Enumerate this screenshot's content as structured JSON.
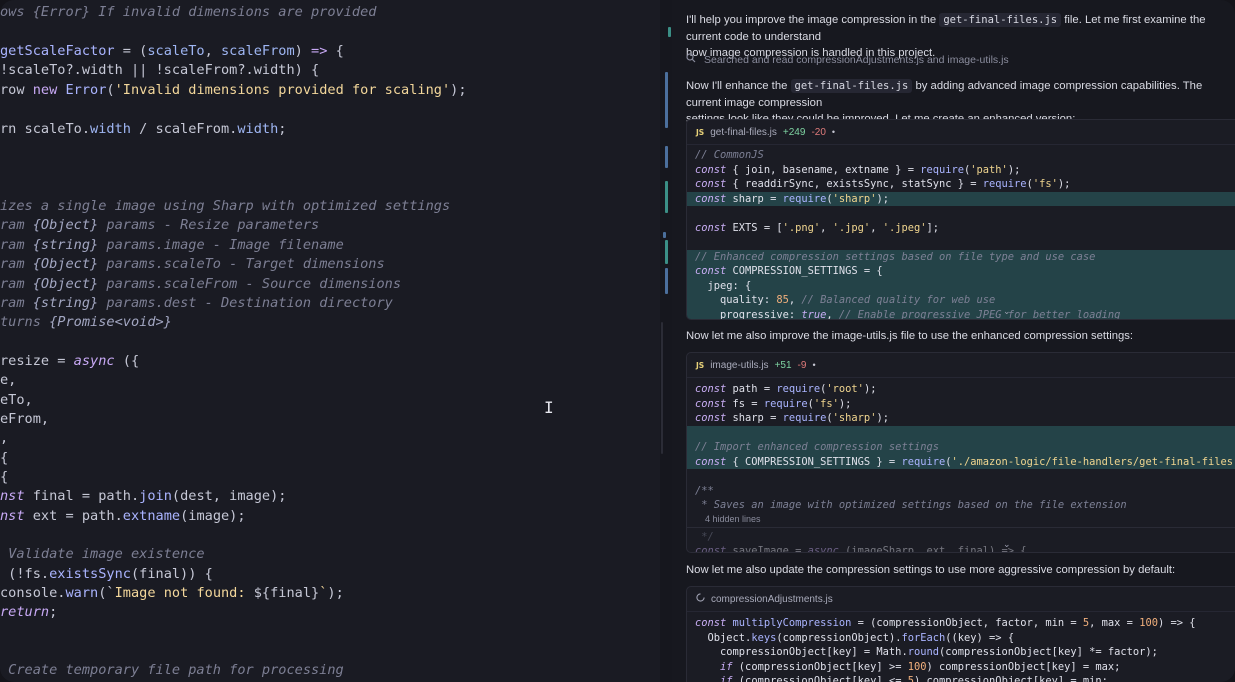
{
  "editor": {
    "lines": [
      [
        [
          "cm",
          "ows {Error} If invalid dimensions are provided"
        ]
      ],
      [],
      [
        [
          "fn",
          "getScaleFactor"
        ],
        [
          "pn",
          " = ("
        ],
        [
          "prop",
          "scaleTo"
        ],
        [
          "pn",
          ", "
        ],
        [
          "prop",
          "scaleFrom"
        ],
        [
          "pn",
          ") "
        ],
        [
          "kw",
          "=>"
        ],
        [
          "pn",
          " {"
        ]
      ],
      [
        [
          "pn",
          "!scaleTo?.width || !scaleFrom?.width) {"
        ]
      ],
      [
        [
          "pn",
          "row "
        ],
        [
          "kw",
          "new"
        ],
        [
          "pn",
          " "
        ],
        [
          "fn",
          "Error"
        ],
        [
          "pn",
          "("
        ],
        [
          "str",
          "'Invalid dimensions provided for scaling'"
        ],
        [
          "pn",
          ");"
        ]
      ],
      [],
      [
        [
          "pn",
          "rn scaleTo."
        ],
        [
          "prop",
          "width"
        ],
        [
          "pn",
          " / scaleFrom."
        ],
        [
          "prop",
          "width"
        ],
        [
          "pn",
          ";"
        ]
      ],
      [],
      [],
      [],
      [
        [
          "cm",
          "izes a single image using Sharp with optimized settings"
        ]
      ],
      [
        [
          "cm",
          "ram "
        ],
        [
          "cmt",
          "{Object}"
        ],
        [
          "cm",
          " params - Resize parameters"
        ]
      ],
      [
        [
          "cm",
          "ram "
        ],
        [
          "cmt",
          "{string}"
        ],
        [
          "cm",
          " params.image - Image filename"
        ]
      ],
      [
        [
          "cm",
          "ram "
        ],
        [
          "cmt",
          "{Object}"
        ],
        [
          "cm",
          " params.scaleTo - Target dimensions"
        ]
      ],
      [
        [
          "cm",
          "ram "
        ],
        [
          "cmt",
          "{Object}"
        ],
        [
          "cm",
          " params.scaleFrom - Source dimensions"
        ]
      ],
      [
        [
          "cm",
          "ram "
        ],
        [
          "cmt",
          "{string}"
        ],
        [
          "cm",
          " params.dest - Destination directory"
        ]
      ],
      [
        [
          "cm",
          "turns "
        ],
        [
          "cmt",
          "{Promise<void>}"
        ]
      ],
      [],
      [
        [
          "pn",
          "resize = "
        ],
        [
          "kwi",
          "async"
        ],
        [
          "pn",
          " ({"
        ]
      ],
      [
        [
          "pn",
          "e,"
        ]
      ],
      [
        [
          "pn",
          "eTo,"
        ]
      ],
      [
        [
          "pn",
          "eFrom,"
        ]
      ],
      [
        [
          "pn",
          ","
        ]
      ],
      [
        [
          "pn",
          "{"
        ]
      ],
      [
        [
          "pn",
          "{"
        ]
      ],
      [
        [
          "kwi",
          "nst"
        ],
        [
          "pn",
          " final = path."
        ],
        [
          "fn",
          "join"
        ],
        [
          "pn",
          "(dest, image);"
        ]
      ],
      [
        [
          "kwi",
          "nst"
        ],
        [
          "pn",
          " ext = path."
        ],
        [
          "fn",
          "extname"
        ],
        [
          "pn",
          "(image);"
        ]
      ],
      [],
      [
        [
          "cm",
          " Validate image existence"
        ]
      ],
      [
        [
          "pn",
          " (!fs."
        ],
        [
          "fn",
          "existsSync"
        ],
        [
          "pn",
          "(final)) {"
        ]
      ],
      [
        [
          "pn",
          "console."
        ],
        [
          "fn",
          "warn"
        ],
        [
          "pn",
          "(`"
        ],
        [
          "str",
          "Image not found: "
        ],
        [
          "pn",
          "${final}"
        ],
        [
          "str",
          "`"
        ],
        [
          "pn",
          ");"
        ]
      ],
      [
        [
          "kwi",
          "return"
        ],
        [
          "pn",
          ";"
        ]
      ],
      [],
      [],
      [
        [
          "cm",
          " Create temporary file path for processing"
        ]
      ]
    ]
  },
  "chat": {
    "intro": [
      "I'll help you improve the image compression in the ",
      "get-final-files.js",
      " file. Let me first examine the current code to understand",
      "how image compression is handled in this project."
    ],
    "searched": "Searched and read compressionAdjustments.js and image-utils.js",
    "msg2": [
      "Now I'll enhance the ",
      "get-final-files.js",
      " by adding advanced image compression capabilities. The current image compression",
      "settings look like they could be improved. Let me create an enhanced version:"
    ],
    "card1": {
      "file": "get-final-files.js",
      "added": "+249",
      "removed": "-20",
      "dot": "•",
      "lines": [
        {
          "hl": false,
          "t": [
            [
              "ccm",
              "// CommonJS"
            ]
          ]
        },
        {
          "hl": false,
          "t": [
            [
              "ckw",
              "const"
            ],
            [
              "p",
              " { join, basename, extname } = "
            ],
            [
              "cfn",
              "require"
            ],
            [
              "p",
              "("
            ],
            [
              "cstr",
              "'path'"
            ],
            [
              "p",
              ");"
            ]
          ]
        },
        {
          "hl": false,
          "t": [
            [
              "ckw",
              "const"
            ],
            [
              "p",
              " { readdirSync, existsSync, statSync } = "
            ],
            [
              "cfn",
              "require"
            ],
            [
              "p",
              "("
            ],
            [
              "cstr",
              "'fs'"
            ],
            [
              "p",
              ");"
            ]
          ]
        },
        {
          "hl": true,
          "t": [
            [
              "ckw",
              "const"
            ],
            [
              "p",
              " sharp = "
            ],
            [
              "cfn",
              "require"
            ],
            [
              "p",
              "("
            ],
            [
              "cstr",
              "'sharp'"
            ],
            [
              "p",
              ");"
            ]
          ]
        },
        {
          "hl": false,
          "t": []
        },
        {
          "hl": false,
          "t": [
            [
              "ckw",
              "const"
            ],
            [
              "p",
              " EXTS = ["
            ],
            [
              "cstr",
              "'.png'"
            ],
            [
              "p",
              ", "
            ],
            [
              "cstr",
              "'.jpg'"
            ],
            [
              "p",
              ", "
            ],
            [
              "cstr",
              "'.jpeg'"
            ],
            [
              "p",
              "];"
            ]
          ]
        },
        {
          "hl": false,
          "t": []
        },
        {
          "hl": true,
          "t": [
            [
              "ccm",
              "// Enhanced compression settings based on file type and use case"
            ]
          ]
        },
        {
          "hl": true,
          "t": [
            [
              "ckw",
              "const"
            ],
            [
              "p",
              " COMPRESSION_SETTINGS = {"
            ]
          ]
        },
        {
          "hl": true,
          "t": [
            [
              "p",
              "  jpeg: {"
            ]
          ]
        },
        {
          "hl": true,
          "t": [
            [
              "p",
              "    quality: "
            ],
            [
              "cnum",
              "85"
            ],
            [
              "p",
              ", "
            ],
            [
              "ccm",
              "// Balanced quality for web use"
            ]
          ]
        },
        {
          "hl": true,
          "t": [
            [
              "p",
              "    progressive: "
            ],
            [
              "ckw",
              "true"
            ],
            [
              "p",
              ", "
            ],
            [
              "ccm",
              "// Enable progressive JPEG for better loading"
            ]
          ]
        }
      ]
    },
    "msg3": "Now let me also improve the image-utils.js file to use the enhanced compression settings:",
    "card2": {
      "file": "image-utils.js",
      "added": "+51",
      "removed": "-9",
      "dot": "•",
      "hidden": "4 hidden lines",
      "lines": [
        {
          "hl": false,
          "t": [
            [
              "ckw",
              "const"
            ],
            [
              "p",
              " path = "
            ],
            [
              "cfn",
              "require"
            ],
            [
              "p",
              "("
            ],
            [
              "cstr",
              "'root'"
            ],
            [
              "p",
              ");"
            ]
          ]
        },
        {
          "hl": false,
          "t": [
            [
              "ckw",
              "const"
            ],
            [
              "p",
              " fs = "
            ],
            [
              "cfn",
              "require"
            ],
            [
              "p",
              "("
            ],
            [
              "cstr",
              "'fs'"
            ],
            [
              "p",
              ");"
            ]
          ]
        },
        {
          "hl": false,
          "t": [
            [
              "ckw",
              "const"
            ],
            [
              "p",
              " sharp = "
            ],
            [
              "cfn",
              "require"
            ],
            [
              "p",
              "("
            ],
            [
              "cstr",
              "'sharp'"
            ],
            [
              "p",
              ");"
            ]
          ]
        },
        {
          "hl": true,
          "t": []
        },
        {
          "hl": true,
          "t": [
            [
              "ccm",
              "// Import enhanced compression settings"
            ]
          ]
        },
        {
          "hl": true,
          "t": [
            [
              "ckw",
              "const"
            ],
            [
              "p",
              " { COMPRESSION_SETTINGS } = "
            ],
            [
              "cfn",
              "require"
            ],
            [
              "p",
              "("
            ],
            [
              "cstr",
              "'./amazon-logic/file-handlers/get-final-files'"
            ],
            [
              "p",
              ");"
            ]
          ]
        },
        {
          "hl": false,
          "t": []
        },
        {
          "hl": false,
          "t": [
            [
              "ccm",
              "/**"
            ]
          ]
        },
        {
          "hl": false,
          "t": [
            [
              "ccm",
              " * Saves an image with optimized settings based on the file extension"
            ]
          ]
        }
      ],
      "after": [
        {
          "hl": false,
          "t": [
            [
              "ccm",
              " */"
            ]
          ]
        },
        {
          "hl": false,
          "t": [
            [
              "ckw",
              "const"
            ],
            [
              "p",
              " saveImage = "
            ],
            [
              "ckw",
              "async"
            ],
            [
              "p",
              " (imageSharp, ext, final) => {"
            ]
          ]
        }
      ]
    },
    "msg4": "Now let me also update the compression settings to use more aggressive compression by default:",
    "card3": {
      "file": "compressionAdjustments.js",
      "lines": [
        {
          "hl": false,
          "t": [
            [
              "ckw",
              "const"
            ],
            [
              "p",
              " "
            ],
            [
              "cfn",
              "multiplyCompression"
            ],
            [
              "p",
              " = (compressionObject, factor, min = "
            ],
            [
              "cnum",
              "5"
            ],
            [
              "p",
              ", max = "
            ],
            [
              "cnum",
              "100"
            ],
            [
              "p",
              ") => {"
            ]
          ]
        },
        {
          "hl": false,
          "t": [
            [
              "p",
              "  Object."
            ],
            [
              "cfn",
              "keys"
            ],
            [
              "p",
              "(compressionObject)."
            ],
            [
              "cfn",
              "forEach"
            ],
            [
              "p",
              "((key) => {"
            ]
          ]
        },
        {
          "hl": false,
          "t": [
            [
              "p",
              "    compressionObject[key] = Math."
            ],
            [
              "cfn",
              "round"
            ],
            [
              "p",
              "(compressionObject[key] *= factor);"
            ]
          ]
        },
        {
          "hl": false,
          "t": [
            [
              "p",
              "    "
            ],
            [
              "ckw",
              "if"
            ],
            [
              "p",
              " (compressionObject[key] >= "
            ],
            [
              "cnum",
              "100"
            ],
            [
              "p",
              ") compressionObject[key] = max;"
            ]
          ]
        },
        {
          "hl": false,
          "t": [
            [
              "p",
              "    "
            ],
            [
              "ckw",
              "if"
            ],
            [
              "p",
              " (compressionObject[key] <= "
            ],
            [
              "cnum",
              "5"
            ],
            [
              "p",
              ") compressionObject[key] = min;"
            ]
          ]
        }
      ]
    }
  }
}
